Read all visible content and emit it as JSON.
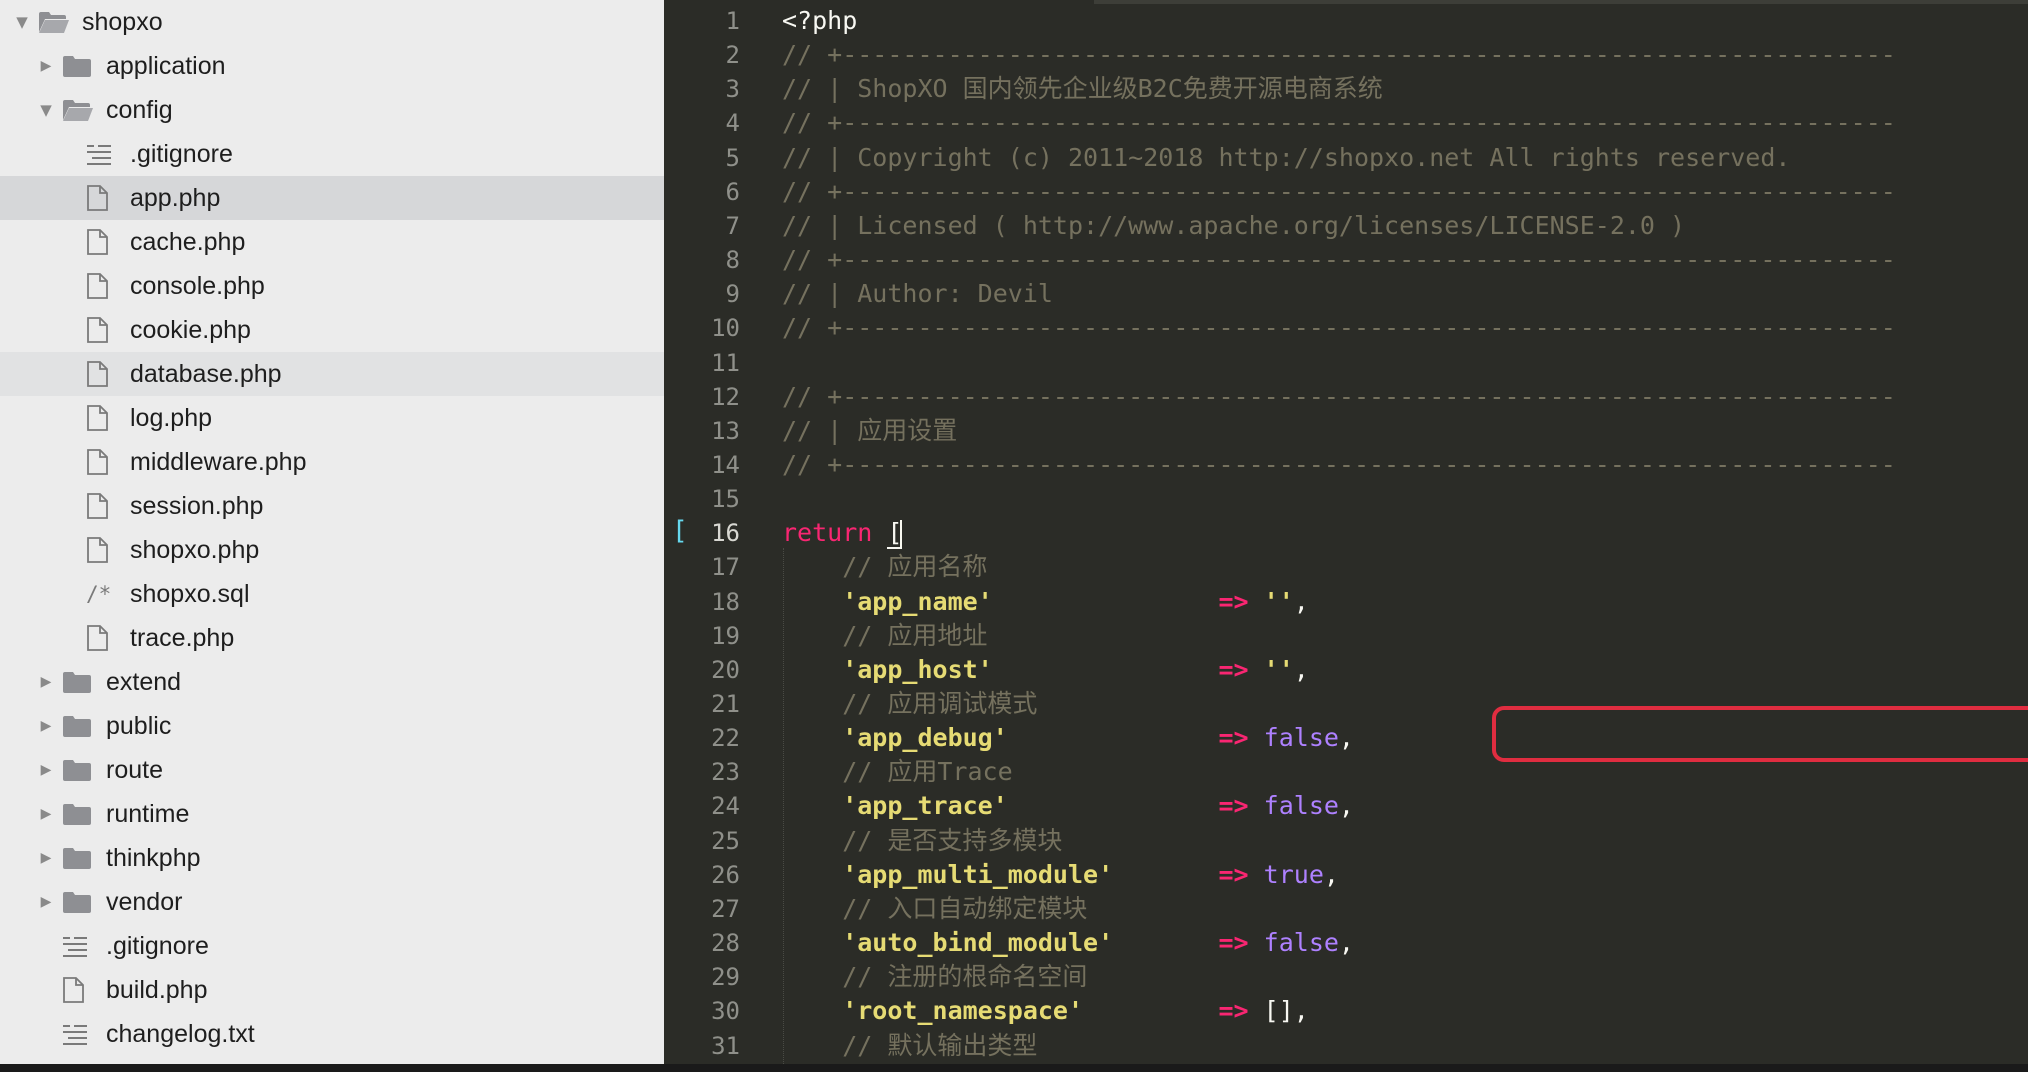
{
  "colors": {
    "sidebar_bg": "#ececec",
    "sidebar_selected": "#d6d7d9",
    "editor_bg": "#2b2c27",
    "comment": "#75715e",
    "keyword": "#f92672",
    "string": "#e6db74",
    "constant": "#ae81ff",
    "highlight_box": "#e02d40",
    "folder_icon": "#8e8f93"
  },
  "sidebar": {
    "items": [
      {
        "label": "shopxo",
        "depth": 0,
        "kind": "folder",
        "expanded": true,
        "icon": "folder-open-icon"
      },
      {
        "label": "application",
        "depth": 1,
        "kind": "folder",
        "expanded": false,
        "icon": "folder-icon"
      },
      {
        "label": "config",
        "depth": 1,
        "kind": "folder",
        "expanded": true,
        "icon": "folder-open-icon"
      },
      {
        "label": ".gitignore",
        "depth": 2,
        "kind": "text",
        "icon": "text-file-icon"
      },
      {
        "label": "app.php",
        "depth": 2,
        "kind": "file",
        "icon": "file-icon",
        "selected": true
      },
      {
        "label": "cache.php",
        "depth": 2,
        "kind": "file",
        "icon": "file-icon"
      },
      {
        "label": "console.php",
        "depth": 2,
        "kind": "file",
        "icon": "file-icon"
      },
      {
        "label": "cookie.php",
        "depth": 2,
        "kind": "file",
        "icon": "file-icon"
      },
      {
        "label": "database.php",
        "depth": 2,
        "kind": "file",
        "icon": "file-icon",
        "hover": true
      },
      {
        "label": "log.php",
        "depth": 2,
        "kind": "file",
        "icon": "file-icon"
      },
      {
        "label": "middleware.php",
        "depth": 2,
        "kind": "file",
        "icon": "file-icon"
      },
      {
        "label": "session.php",
        "depth": 2,
        "kind": "file",
        "icon": "file-icon"
      },
      {
        "label": "shopxo.php",
        "depth": 2,
        "kind": "file",
        "icon": "file-icon"
      },
      {
        "label": "shopxo.sql",
        "depth": 2,
        "kind": "sql",
        "icon": "sql-file-icon",
        "glyph": "/*"
      },
      {
        "label": "trace.php",
        "depth": 2,
        "kind": "file",
        "icon": "file-icon"
      },
      {
        "label": "extend",
        "depth": 1,
        "kind": "folder",
        "expanded": false,
        "icon": "folder-icon"
      },
      {
        "label": "public",
        "depth": 1,
        "kind": "folder",
        "expanded": false,
        "icon": "folder-icon"
      },
      {
        "label": "route",
        "depth": 1,
        "kind": "folder",
        "expanded": false,
        "icon": "folder-icon"
      },
      {
        "label": "runtime",
        "depth": 1,
        "kind": "folder",
        "expanded": false,
        "icon": "folder-icon"
      },
      {
        "label": "thinkphp",
        "depth": 1,
        "kind": "folder",
        "expanded": false,
        "icon": "folder-icon"
      },
      {
        "label": "vendor",
        "depth": 1,
        "kind": "folder",
        "expanded": false,
        "icon": "folder-icon"
      },
      {
        "label": ".gitignore",
        "depth": 1,
        "kind": "text",
        "icon": "text-file-icon"
      },
      {
        "label": "build.php",
        "depth": 1,
        "kind": "file",
        "icon": "file-icon"
      },
      {
        "label": "changelog.txt",
        "depth": 1,
        "kind": "text",
        "icon": "text-file-icon"
      }
    ]
  },
  "editor": {
    "fold_marker": "[",
    "active_line": 16,
    "highlighted_line": 22,
    "lines": [
      {
        "n": "1",
        "tokens": [
          {
            "t": "<?php",
            "c": "php"
          }
        ]
      },
      {
        "n": "2",
        "tokens": [
          {
            "t": "// +----------------------------------------------------------------------",
            "c": "comment"
          }
        ]
      },
      {
        "n": "3",
        "tokens": [
          {
            "t": "// | ShopXO 国内领先企业级B2C免费开源电商系统",
            "c": "comment"
          }
        ]
      },
      {
        "n": "4",
        "tokens": [
          {
            "t": "// +----------------------------------------------------------------------",
            "c": "comment"
          }
        ]
      },
      {
        "n": "5",
        "tokens": [
          {
            "t": "// | Copyright (c) 2011~2018 http://shopxo.net All rights reserved.",
            "c": "comment"
          }
        ]
      },
      {
        "n": "6",
        "tokens": [
          {
            "t": "// +----------------------------------------------------------------------",
            "c": "comment"
          }
        ]
      },
      {
        "n": "7",
        "tokens": [
          {
            "t": "// | Licensed ( http://www.apache.org/licenses/LICENSE-2.0 )",
            "c": "comment"
          }
        ]
      },
      {
        "n": "8",
        "tokens": [
          {
            "t": "// +----------------------------------------------------------------------",
            "c": "comment"
          }
        ]
      },
      {
        "n": "9",
        "tokens": [
          {
            "t": "// | Author: Devil",
            "c": "comment"
          }
        ]
      },
      {
        "n": "10",
        "tokens": [
          {
            "t": "// +----------------------------------------------------------------------",
            "c": "comment"
          }
        ]
      },
      {
        "n": "11",
        "tokens": []
      },
      {
        "n": "12",
        "tokens": [
          {
            "t": "// +----------------------------------------------------------------------",
            "c": "comment"
          }
        ]
      },
      {
        "n": "13",
        "tokens": [
          {
            "t": "// | 应用设置",
            "c": "comment"
          }
        ]
      },
      {
        "n": "14",
        "tokens": [
          {
            "t": "// +----------------------------------------------------------------------",
            "c": "comment"
          }
        ]
      },
      {
        "n": "15",
        "tokens": []
      },
      {
        "n": "16",
        "tokens": [
          {
            "t": "return ",
            "c": "kw"
          },
          {
            "t": "[",
            "c": "bracket"
          }
        ]
      },
      {
        "n": "17",
        "tokens": [
          {
            "t": "    // 应用名称",
            "c": "comment"
          }
        ]
      },
      {
        "n": "18",
        "tokens": [
          {
            "t": "    'app_name'",
            "c": "str"
          },
          {
            "t": "               ",
            "c": "punc"
          },
          {
            "t": "=>",
            "c": "op"
          },
          {
            "t": " ''",
            "c": "str"
          },
          {
            "t": ",",
            "c": "punc"
          }
        ]
      },
      {
        "n": "19",
        "tokens": [
          {
            "t": "    // 应用地址",
            "c": "comment"
          }
        ]
      },
      {
        "n": "20",
        "tokens": [
          {
            "t": "    'app_host'",
            "c": "str"
          },
          {
            "t": "               ",
            "c": "punc"
          },
          {
            "t": "=>",
            "c": "op"
          },
          {
            "t": " ''",
            "c": "str"
          },
          {
            "t": ",",
            "c": "punc"
          }
        ]
      },
      {
        "n": "21",
        "tokens": [
          {
            "t": "    // 应用调试模式",
            "c": "comment"
          }
        ]
      },
      {
        "n": "22",
        "tokens": [
          {
            "t": "    'app_debug'",
            "c": "str"
          },
          {
            "t": "              ",
            "c": "punc"
          },
          {
            "t": "=>",
            "c": "op"
          },
          {
            "t": " false",
            "c": "const"
          },
          {
            "t": ",",
            "c": "punc"
          }
        ]
      },
      {
        "n": "23",
        "tokens": [
          {
            "t": "    // 应用Trace",
            "c": "comment"
          }
        ]
      },
      {
        "n": "24",
        "tokens": [
          {
            "t": "    'app_trace'",
            "c": "str"
          },
          {
            "t": "              ",
            "c": "punc"
          },
          {
            "t": "=>",
            "c": "op"
          },
          {
            "t": " false",
            "c": "const"
          },
          {
            "t": ",",
            "c": "punc"
          }
        ]
      },
      {
        "n": "25",
        "tokens": [
          {
            "t": "    // 是否支持多模块",
            "c": "comment"
          }
        ]
      },
      {
        "n": "26",
        "tokens": [
          {
            "t": "    'app_multi_module'",
            "c": "str"
          },
          {
            "t": "       ",
            "c": "punc"
          },
          {
            "t": "=>",
            "c": "op"
          },
          {
            "t": " true",
            "c": "const"
          },
          {
            "t": ",",
            "c": "punc"
          }
        ]
      },
      {
        "n": "27",
        "tokens": [
          {
            "t": "    // 入口自动绑定模块",
            "c": "comment"
          }
        ]
      },
      {
        "n": "28",
        "tokens": [
          {
            "t": "    'auto_bind_module'",
            "c": "str"
          },
          {
            "t": "       ",
            "c": "punc"
          },
          {
            "t": "=>",
            "c": "op"
          },
          {
            "t": " false",
            "c": "const"
          },
          {
            "t": ",",
            "c": "punc"
          }
        ]
      },
      {
        "n": "29",
        "tokens": [
          {
            "t": "    // 注册的根命名空间",
            "c": "comment"
          }
        ]
      },
      {
        "n": "30",
        "tokens": [
          {
            "t": "    'root_namespace'",
            "c": "str"
          },
          {
            "t": "         ",
            "c": "punc"
          },
          {
            "t": "=>",
            "c": "op"
          },
          {
            "t": " []",
            "c": "punc"
          },
          {
            "t": ",",
            "c": "punc"
          }
        ]
      },
      {
        "n": "31",
        "tokens": [
          {
            "t": "    // 默认输出类型",
            "c": "comment"
          }
        ]
      }
    ]
  }
}
